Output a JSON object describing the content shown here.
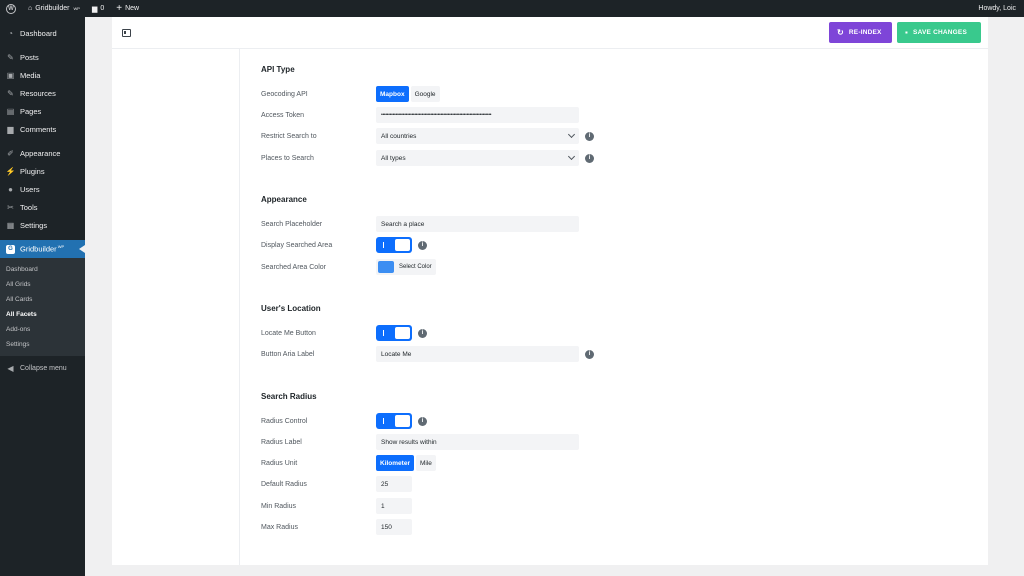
{
  "adminbar": {
    "site": "Gridbuilder",
    "site_sup": "WP",
    "comments": "0",
    "new": "New",
    "howdy": "Howdy, Loic"
  },
  "sidebar": {
    "items": [
      {
        "label": "Dashboard",
        "icon": "dashboard-icon"
      },
      {
        "label": "Posts",
        "icon": "pin-icon"
      },
      {
        "label": "Media",
        "icon": "media-icon"
      },
      {
        "label": "Resources",
        "icon": "pin-icon"
      },
      {
        "label": "Pages",
        "icon": "page-icon"
      },
      {
        "label": "Comments",
        "icon": "comment-icon"
      },
      {
        "label": "Appearance",
        "icon": "brush-icon"
      },
      {
        "label": "Plugins",
        "icon": "plug-icon"
      },
      {
        "label": "Users",
        "icon": "user-icon"
      },
      {
        "label": "Tools",
        "icon": "wrench-icon"
      },
      {
        "label": "Settings",
        "icon": "settings-icon"
      }
    ],
    "active": {
      "label": "Gridbuilder",
      "sup": "WP"
    },
    "submenu": [
      "Dashboard",
      "All Grids",
      "All Cards",
      "All Facets",
      "Add-ons",
      "Settings"
    ],
    "current_sub": "All Facets",
    "collapse": "Collapse menu"
  },
  "toolbar": {
    "reindex": "RE-INDEX",
    "save": "SAVE CHANGES",
    "reindex_color": "#7e45d8",
    "save_color": "#39c98d"
  },
  "sections": {
    "api": {
      "title": "API Type",
      "geocoding_label": "Geocoding API",
      "geocoding_options": [
        "Mapbox",
        "Google"
      ],
      "geocoding_selected": "Mapbox",
      "token_label": "Access Token",
      "token_value": "••••••••••••••••••••••••••••••••••••••••••••••••••••••••••••••••••••••••••••",
      "restrict_label": "Restrict Search to",
      "restrict_value": "All countries",
      "places_label": "Places to Search",
      "places_value": "All types"
    },
    "appearance": {
      "title": "Appearance",
      "placeholder_label": "Search Placeholder",
      "placeholder_value": "Search a place",
      "display_label": "Display Searched Area",
      "display_on": true,
      "color_label": "Searched Area Color",
      "color_button": "Select Color",
      "color_value": "#3c8ef2"
    },
    "location": {
      "title": "User's Location",
      "locate_label": "Locate Me Button",
      "locate_on": true,
      "aria_label": "Button Aria Label",
      "aria_value": "Locate Me"
    },
    "radius": {
      "title": "Search Radius",
      "control_label": "Radius Control",
      "control_on": true,
      "radius_label_label": "Radius Label",
      "radius_label_value": "Show results within",
      "unit_label": "Radius Unit",
      "unit_options": [
        "Kilometer",
        "Mile"
      ],
      "unit_selected": "Kilometer",
      "default_label": "Default Radius",
      "default_value": "25",
      "min_label": "Min Radius",
      "min_value": "1",
      "max_label": "Max Radius",
      "max_value": "150"
    }
  },
  "accent_color": "#0d6efd"
}
